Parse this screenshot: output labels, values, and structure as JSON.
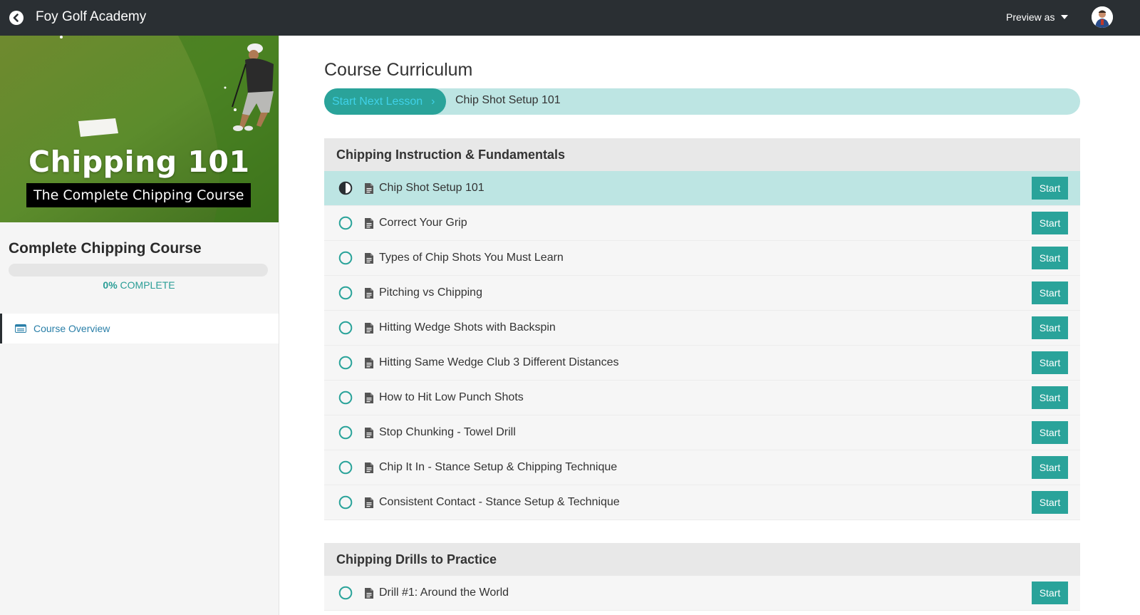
{
  "topbar": {
    "title": "Foy Golf Academy",
    "preview_label": "Preview as",
    "back_icon": "arrow-left-circle-icon",
    "bg_color": "#2a2f33"
  },
  "sidebar": {
    "hero": {
      "title": "Chipping 101",
      "subtitle": "The Complete Chipping Course"
    },
    "course_name": "Complete Chipping Course",
    "progress": {
      "percent_value": 0,
      "percent": "0%",
      "label": "COMPLETE"
    },
    "nav": [
      {
        "label": "Course Overview",
        "icon": "card-list-icon"
      }
    ]
  },
  "main": {
    "title": "Course Curriculum",
    "next_lesson_button": "Start Next Lesson",
    "next_lesson_title": "Chip Shot Setup 101",
    "sections": [
      {
        "title": "Chipping Instruction & Fundamentals",
        "lessons": [
          {
            "title": "Chip Shot Setup 101",
            "status": "in-progress",
            "button": "Start"
          },
          {
            "title": "Correct Your Grip",
            "status": "not-started",
            "button": "Start"
          },
          {
            "title": "Types of Chip Shots You Must Learn",
            "status": "not-started",
            "button": "Start"
          },
          {
            "title": "Pitching vs Chipping",
            "status": "not-started",
            "button": "Start"
          },
          {
            "title": "Hitting Wedge Shots with Backspin",
            "status": "not-started",
            "button": "Start"
          },
          {
            "title": "Hitting Same Wedge Club 3 Different Distances",
            "status": "not-started",
            "button": "Start"
          },
          {
            "title": "How to Hit Low Punch Shots",
            "status": "not-started",
            "button": "Start"
          },
          {
            "title": "Stop Chunking - Towel Drill",
            "status": "not-started",
            "button": "Start"
          },
          {
            "title": "Chip It In - Stance Setup & Chipping Technique",
            "status": "not-started",
            "button": "Start"
          },
          {
            "title": "Consistent Contact - Stance Setup & Technique",
            "status": "not-started",
            "button": "Start"
          }
        ]
      },
      {
        "title": "Chipping Drills to Practice",
        "lessons": [
          {
            "title": "Drill #1: Around the World",
            "status": "not-started",
            "button": "Start"
          }
        ]
      }
    ]
  },
  "colors": {
    "accent": "#2aa39a",
    "accent_light": "#bde5e3",
    "link": "#2a7fa8"
  }
}
